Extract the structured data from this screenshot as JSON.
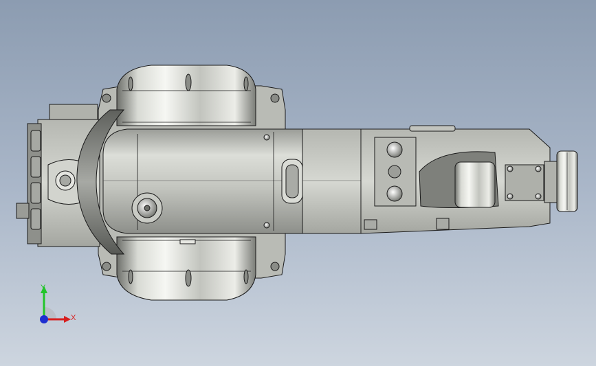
{
  "viewport": {
    "background_top": "#8c9cb1",
    "background_bottom": "#cdd5df"
  },
  "model": {
    "part_type": "robot-arm-assembly",
    "view": "top",
    "body_color": "#c9cbc4",
    "edge_color": "#1a1a1a"
  },
  "triad": {
    "y_label": "Y",
    "x_label": "X",
    "y_color": "#22c52a",
    "x_color": "#d71e1e",
    "z_color": "#1e2fd0"
  }
}
